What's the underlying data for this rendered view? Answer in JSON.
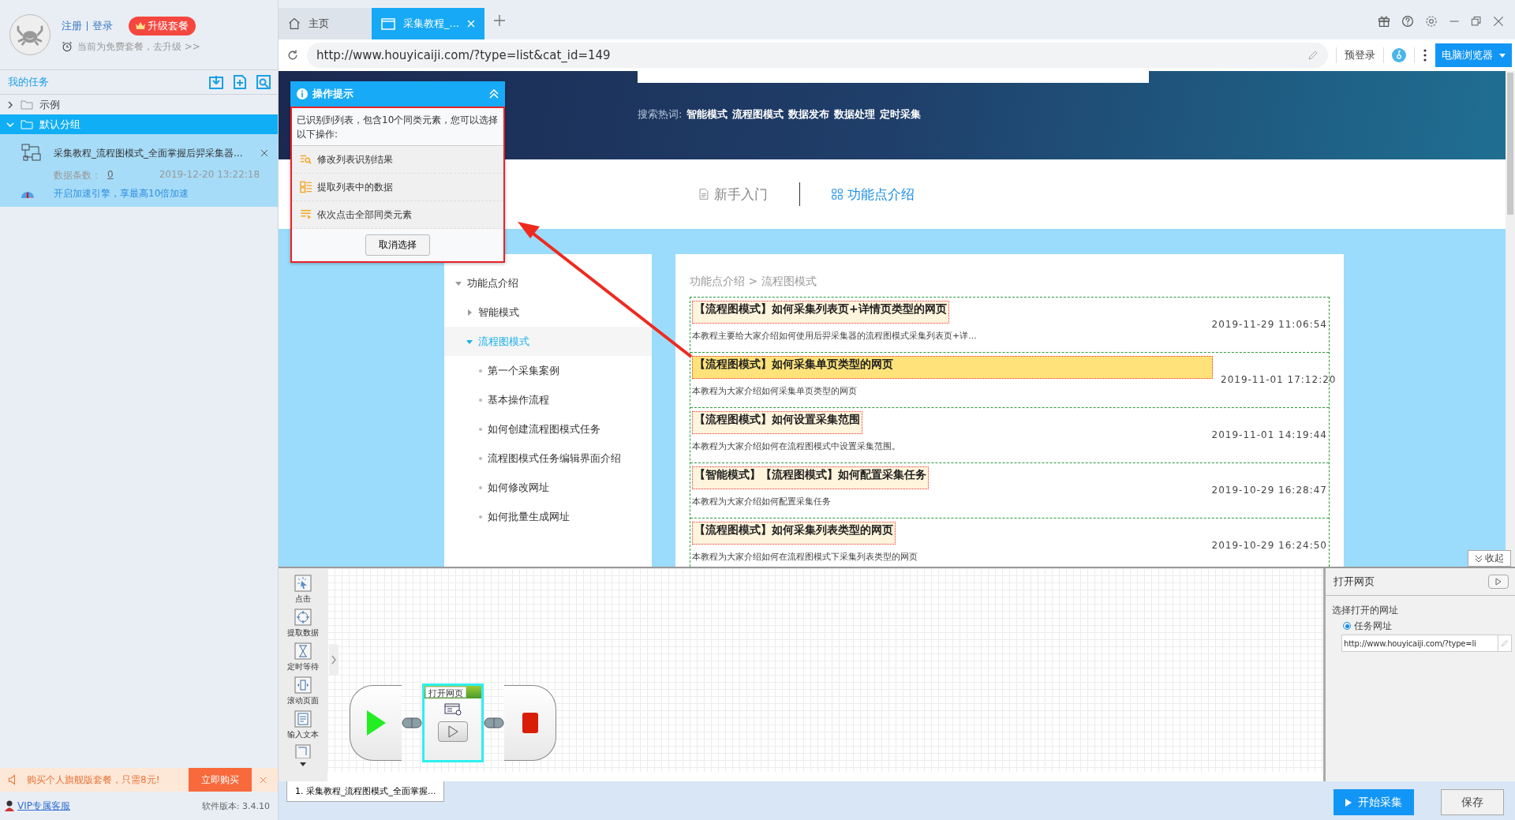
{
  "account": {
    "register": "注册",
    "login": "登录",
    "upgrade_badge": "升级套餐",
    "plan_note": "当前为免费套餐，去升级 >>"
  },
  "tasks": {
    "title": "我的任务",
    "groups": [
      {
        "name": "示例",
        "expanded": false,
        "selected": false
      },
      {
        "name": "默认分组",
        "expanded": true,
        "selected": true,
        "tasks": [
          {
            "title": "采集教程_流程图模式_全面掌握后羿采集器...",
            "count_label": "数据条数：",
            "count": "0",
            "time": "2019-12-20 13:22:18",
            "boost": "开启加速引擎，享最高10倍加速"
          }
        ]
      }
    ]
  },
  "promo": {
    "text": "购买个人旗舰版套餐，只需8元!",
    "button": "立即购买"
  },
  "footer": {
    "support": "VIP专属客服",
    "version": "软件版本: 3.4.10"
  },
  "browser": {
    "tabs": [
      {
        "kind": "home",
        "label": "主页",
        "selected": false
      },
      {
        "kind": "page",
        "label": "采集教程_...",
        "selected": true
      }
    ],
    "url": "http://www.houyicaiji.com/?type=list&cat_id=149",
    "prelogin": "预登录",
    "mode_button": "电脑浏览器"
  },
  "page": {
    "hot_label": "搜索热词:",
    "hot_words": [
      "智能模式",
      "流程图模式",
      "数据发布",
      "数据处理",
      "定时采集"
    ],
    "nav_tabs": [
      {
        "label": "新手入门",
        "selected": false
      },
      {
        "label": "功能点介绍",
        "selected": true
      }
    ],
    "sidebar": [
      {
        "label": "功能点介绍",
        "expanded": true,
        "selected": false,
        "children": [
          {
            "label": "智能模式",
            "expanded": false,
            "selected": false
          },
          {
            "label": "流程图模式",
            "expanded": true,
            "selected": true,
            "children": [
              {
                "label": "第一个采集案例",
                "selected": false
              },
              {
                "label": "基本操作流程",
                "selected": false
              },
              {
                "label": "如何创建流程图模式任务",
                "selected": false
              },
              {
                "label": "流程图模式任务编辑界面介绍",
                "selected": false
              },
              {
                "label": "如何修改网址",
                "selected": false
              },
              {
                "label": "如何批量生成网址",
                "selected": false
              }
            ]
          }
        ]
      }
    ],
    "breadcrumb": "功能点介绍 > 流程图模式",
    "articles": [
      {
        "title": "【流程图模式】如何采集列表页+详情页类型的网页",
        "summary": "本教程主要给大家介绍如何使用后羿采集器的流程图模式采集列表页+详...",
        "date": "2019-11-29 11:06:54",
        "highlighted": false
      },
      {
        "title": "【流程图模式】如何采集单页类型的网页",
        "summary": "本教程为大家介绍如何采集单页类型的网页",
        "date": "2019-11-01 17:12:20",
        "highlighted": true
      },
      {
        "title": "【流程图模式】如何设置采集范围",
        "summary": "本教程为大家介绍如何在流程图模式中设置采集范围。",
        "date": "2019-11-01 14:19:44",
        "highlighted": false
      },
      {
        "title": "【智能模式】【流程图模式】如何配置采集任务",
        "summary": "本教程为大家介绍如何配置采集任务",
        "date": "2019-10-29 16:28:47",
        "highlighted": false
      },
      {
        "title": "【流程图模式】如何采集列表类型的网页",
        "summary": "本教程为大家介绍如何在流程图模式下采集列表类型的网页",
        "date": "2019-10-29 16:24:50",
        "highlighted": false
      }
    ]
  },
  "tip_popup": {
    "title": "操作提示",
    "message": "已识别到列表，包含10个同类元素，您可以选择以下操作:",
    "actions": [
      {
        "kind": "edit",
        "label": "修改列表识别结果"
      },
      {
        "kind": "extract",
        "label": "提取列表中的数据"
      },
      {
        "kind": "click",
        "label": "依次点击全部同类元素"
      }
    ],
    "cancel": "取消选择"
  },
  "collapse_button": "收起",
  "toolbox": [
    {
      "kind": "click",
      "label": "点击"
    },
    {
      "kind": "extract",
      "label": "提取数据"
    },
    {
      "kind": "wait",
      "label": "定时等待"
    },
    {
      "kind": "scroll",
      "label": "滚动页面"
    },
    {
      "kind": "input",
      "label": "输入文本"
    }
  ],
  "flow": {
    "nodes": [
      {
        "kind": "start"
      },
      {
        "kind": "step",
        "label": "打开网页",
        "selected": true
      },
      {
        "kind": "end"
      }
    ]
  },
  "properties": {
    "title": "打开网页",
    "field_label": "选择打开的网址",
    "options": [
      {
        "label": "任务网址",
        "selected": true
      }
    ],
    "url_value": "http://www.houyicaiji.com/?type=li"
  },
  "task_tabs": [
    {
      "label": "1. 采集教程_流程图模式_全面掌握...",
      "selected": true
    }
  ],
  "actions": {
    "start": "开始采集",
    "save": "保存"
  }
}
